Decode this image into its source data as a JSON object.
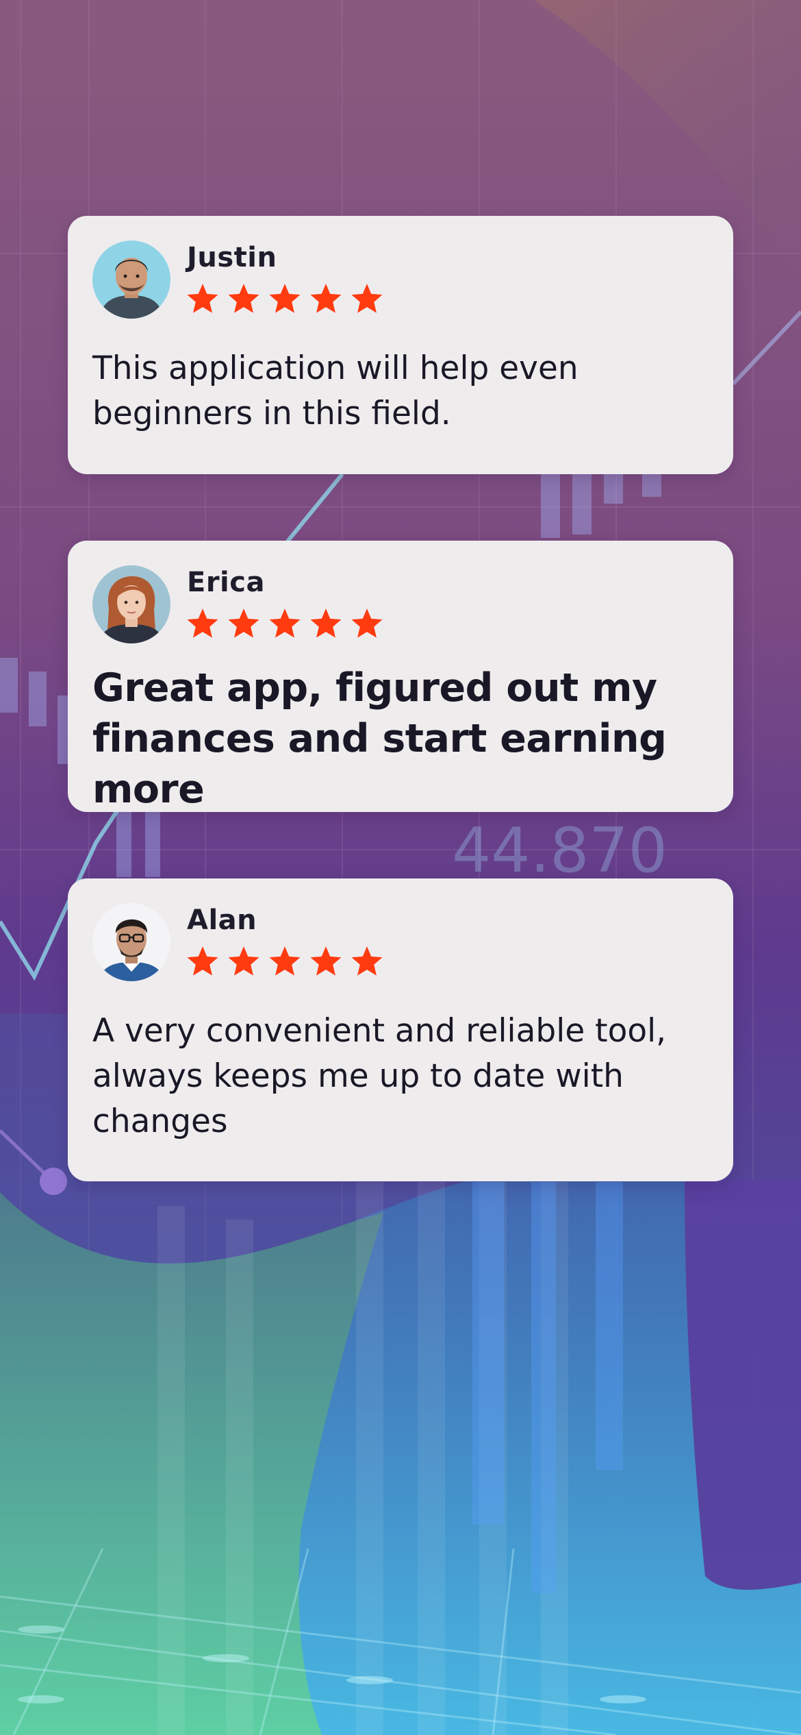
{
  "colors": {
    "card_background": "#efecee",
    "star": "#ff3b0f",
    "text": "#1a1826",
    "background_top": "#8a5a7e",
    "background_mid": "#6a3f8c",
    "background_bottom": "#3fa8b8"
  },
  "background": {
    "watermark_value": "44.870"
  },
  "reviews": [
    {
      "name": "Justin",
      "rating": 5,
      "rating_max": 5,
      "text": "This application will help even beginners in this field.",
      "avatar_icon": "man-avatar-icon"
    },
    {
      "name": "Erica",
      "rating": 5,
      "rating_max": 5,
      "text": "Great app, figured out my finances and start earning more",
      "avatar_icon": "woman-avatar-icon"
    },
    {
      "name": "Alan",
      "rating": 5,
      "rating_max": 5,
      "text": "A very convenient and reliable tool, always keeps me up to date with changes",
      "avatar_icon": "man-with-glasses-avatar-icon"
    }
  ]
}
